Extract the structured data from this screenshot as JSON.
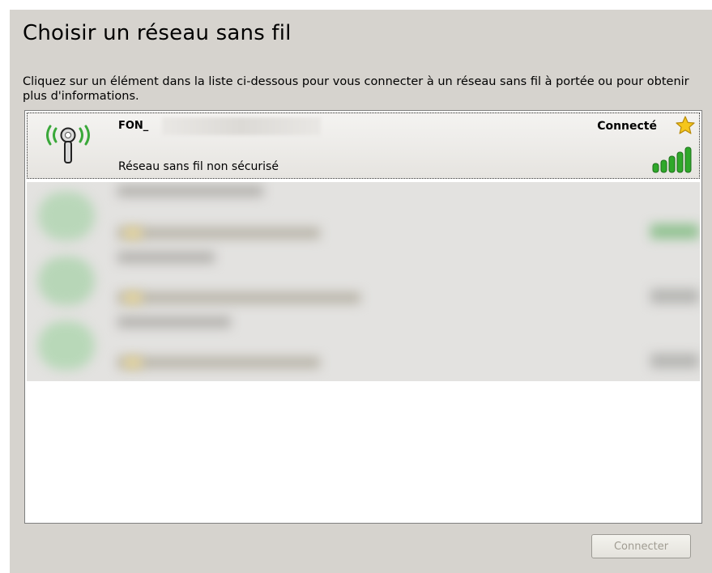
{
  "dialog": {
    "title": "Choisir un réseau sans fil",
    "description": "Cliquez sur un élément dans la liste ci-dessous pour vous connecter à un réseau sans fil à portée ou pour obtenir plus d'informations."
  },
  "networks": [
    {
      "ssid": "FON_",
      "status": "Connecté",
      "security": "Réseau sans fil non sécurisé",
      "signal_bars": 5,
      "icons": {
        "network": "wireless-antenna-icon",
        "preferred": "star-icon",
        "signal": "signal-strength-icon"
      }
    }
  ],
  "buttons": {
    "connect_label": "Connecter",
    "connect_enabled": false
  },
  "colors": {
    "panel": "#d6d3ce",
    "list_background": "#ffffff",
    "signal_green": "#2fa82a",
    "star": "#f5c61b",
    "disabled_text": "#a09c92"
  }
}
